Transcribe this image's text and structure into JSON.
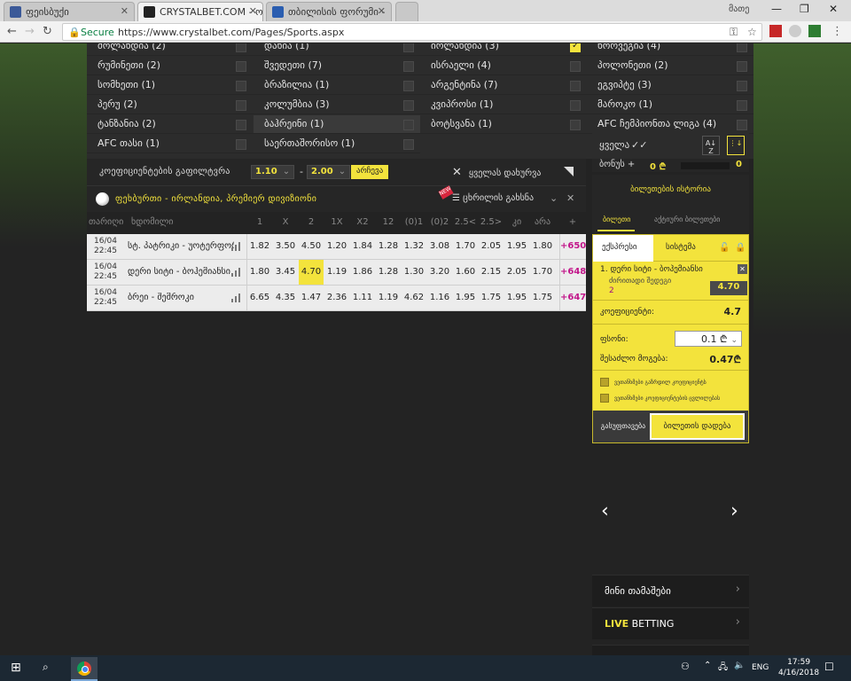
{
  "browser": {
    "tabs": [
      {
        "title": "ფეისბუქი",
        "favicon_color": "#3b5998"
      },
      {
        "title": "CRYSTALBET.COM - ონლ",
        "favicon_color": "#222222"
      },
      {
        "title": "თბილისის ფორუმი -",
        "favicon_color": "#2a5db0"
      }
    ],
    "user_name": "მათე",
    "secure_label": "Secure",
    "url": "https://www.crystalbet.com/Pages/Sports.aspx"
  },
  "countries": {
    "col1": [
      {
        "label": "მოლანდია",
        "count": "(2)"
      },
      {
        "label": "რუმინეთი",
        "count": "(2)"
      },
      {
        "label": "სომხეთი",
        "count": "(1)"
      },
      {
        "label": "პერუ",
        "count": "(2)"
      },
      {
        "label": "ტანზანია",
        "count": "(2)"
      },
      {
        "label": "AFC თასი",
        "count": "(1)"
      }
    ],
    "col2": [
      {
        "label": "დანია",
        "count": "(1)"
      },
      {
        "label": "შვედეთი",
        "count": "(7)"
      },
      {
        "label": "ბრაზილია",
        "count": "(1)"
      },
      {
        "label": "კოლუმბია",
        "count": "(3)"
      },
      {
        "label": "ბაჰრეინი",
        "count": "(1)"
      },
      {
        "label": "საერთაშორისო",
        "count": "(1)"
      }
    ],
    "col3": [
      {
        "label": "ირლანდია",
        "count": "(3)",
        "checked": true
      },
      {
        "label": "ისრაელი",
        "count": "(4)"
      },
      {
        "label": "არგენტინა",
        "count": "(7)"
      },
      {
        "label": "კვიპროსი",
        "count": "(1)"
      },
      {
        "label": "ბოტსვანა",
        "count": "(1)"
      }
    ],
    "col4": [
      {
        "label": "ნორვეგია",
        "count": "(4)"
      },
      {
        "label": "პოლონეთი",
        "count": "(2)"
      },
      {
        "label": "ეგვიპტე",
        "count": "(3)"
      },
      {
        "label": "მაროკო",
        "count": "(1)"
      },
      {
        "label": "AFC ჩემპიონთა ლიგა",
        "count": "(4)"
      }
    ],
    "all_label": "ყველა",
    "sort_az": "A\nZ"
  },
  "filter": {
    "label": "კოეფიციენტების გაფილტვრა",
    "from": "1.10",
    "dash": "-",
    "to": "2.00",
    "apply": "არჩევა",
    "close_all": "ყველას დახურვა"
  },
  "event": {
    "title": "ფეხბურთი - ირლანდია, პრემიერ დივიზიონი",
    "table_btn": "ცხრილის გახსნა"
  },
  "columns": {
    "date": "თარიღი",
    "event": "ხდომილი",
    "odds": [
      "1",
      "X",
      "2",
      "1X",
      "X2",
      "12",
      "(0)1",
      "(0)2",
      "2.5<",
      "2.5>",
      "კი",
      "არა",
      "+"
    ]
  },
  "matches": [
    {
      "date": "16/04",
      "time": "22:45",
      "teams": "სტ. პატრიკი - უოტერფორდი",
      "odds": [
        "1.82",
        "3.50",
        "4.50",
        "1.20",
        "1.84",
        "1.28",
        "1.32",
        "3.08",
        "1.70",
        "2.05",
        "1.95",
        "1.80"
      ],
      "more": "+650"
    },
    {
      "date": "16/04",
      "time": "22:45",
      "teams": "დერი სიტი - ბოჰემიანსი",
      "odds": [
        "1.80",
        "3.45",
        "4.70",
        "1.19",
        "1.86",
        "1.28",
        "1.30",
        "3.20",
        "1.60",
        "2.15",
        "2.05",
        "1.70"
      ],
      "more": "+648",
      "highlight": 2
    },
    {
      "date": "16/04",
      "time": "22:45",
      "teams": "ბრეი - შემროკი",
      "odds": [
        "6.65",
        "4.35",
        "1.47",
        "2.36",
        "1.11",
        "1.19",
        "4.62",
        "1.16",
        "1.95",
        "1.75",
        "1.95",
        "1.75"
      ],
      "more": "+647"
    }
  ],
  "betslip": {
    "bonus_label": "ბონუს +",
    "bonus_value": "0",
    "bonus_currency": "₾",
    "bonus_end": "0",
    "history": "ბილეთების ისტორია",
    "tab_ticket": "ბილეთი",
    "tab_quick": "აქტიური ბილეთები",
    "mode_express": "ექსპრესი",
    "mode_system": "სისტემა",
    "item_title": "1. დერი სიტი - ბოჰემიანსი",
    "item_market": "ძირითადი შედეგი",
    "item_pick": "2",
    "item_odd": "4.70",
    "coef_label": "კოეფიციენტი:",
    "coef_value": "4.7",
    "stake_label": "ფსონი:",
    "stake_value": "0.1",
    "win_label": "შესაძლო მოგება:",
    "win_value": "0.47",
    "opt1": "ვეთანხმები გაზრდილ კოეფიციენტს",
    "opt2": "ვეთანხმები კოეფიციენტების ცვლილებას",
    "clear_btn": "გასუფთავება",
    "place_btn": "ბილეთის დადება"
  },
  "panels": {
    "mini_games": "მინი თამაშები",
    "live_bold": "LIVE",
    "live_rest": " BETTING"
  },
  "taskbar": {
    "lang": "ENG",
    "time": "17:59",
    "date": "4/16/2018"
  },
  "colors": {
    "accent": "#f3e33c",
    "more_link": "#c2168a"
  }
}
